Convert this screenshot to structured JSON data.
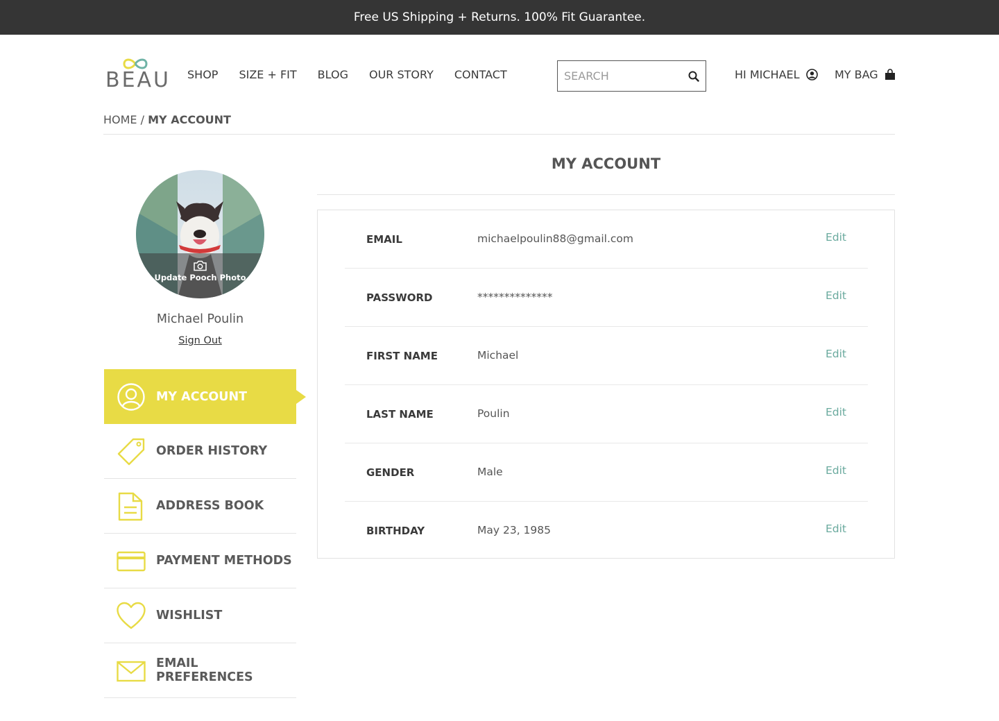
{
  "promo": {
    "text": "Free US Shipping + Returns. 100% Fit Guarantee."
  },
  "header": {
    "logo_text": "BEAU",
    "nav": [
      "SHOP",
      "SIZE + FIT",
      "BLOG",
      "OUR STORY",
      "CONTACT"
    ],
    "search_placeholder": "SEARCH",
    "greeting": "HI MICHAEL",
    "bag_label": "MY BAG"
  },
  "breadcrumb": {
    "home": "HOME",
    "separator": "/",
    "current": "MY ACCOUNT"
  },
  "profile": {
    "photo_label": "Update Pooch Photo",
    "name": "Michael Poulin",
    "sign_out": "Sign Out"
  },
  "sidebar": {
    "items": [
      {
        "label": "MY ACCOUNT",
        "icon": "user-circle-icon",
        "active": true
      },
      {
        "label": "ORDER HISTORY",
        "icon": "tag-icon",
        "active": false
      },
      {
        "label": "ADDRESS BOOK",
        "icon": "document-icon",
        "active": false
      },
      {
        "label": "PAYMENT METHODS",
        "icon": "credit-card-icon",
        "active": false
      },
      {
        "label": "WISHLIST",
        "icon": "heart-icon",
        "active": false
      },
      {
        "label": "EMAIL PREFERENCES",
        "icon": "envelope-icon",
        "active": false
      }
    ]
  },
  "main": {
    "title": "MY ACCOUNT",
    "edit_label": "Edit",
    "fields": [
      {
        "label": "EMAIL",
        "value": "michaelpoulin88@gmail.com"
      },
      {
        "label": "PASSWORD",
        "value": "**************"
      },
      {
        "label": "FIRST NAME",
        "value": "Michael"
      },
      {
        "label": "LAST NAME",
        "value": "Poulin"
      },
      {
        "label": "GENDER",
        "value": "Male"
      },
      {
        "label": "BIRTHDAY",
        "value": "May 23, 1985"
      }
    ]
  },
  "colors": {
    "promo_bg": "#353535",
    "accent_yellow": "#e8db45",
    "edit_teal": "#6aaa9e",
    "logo_teal": "#6fb3a6",
    "logo_yellow": "#e8db45"
  }
}
